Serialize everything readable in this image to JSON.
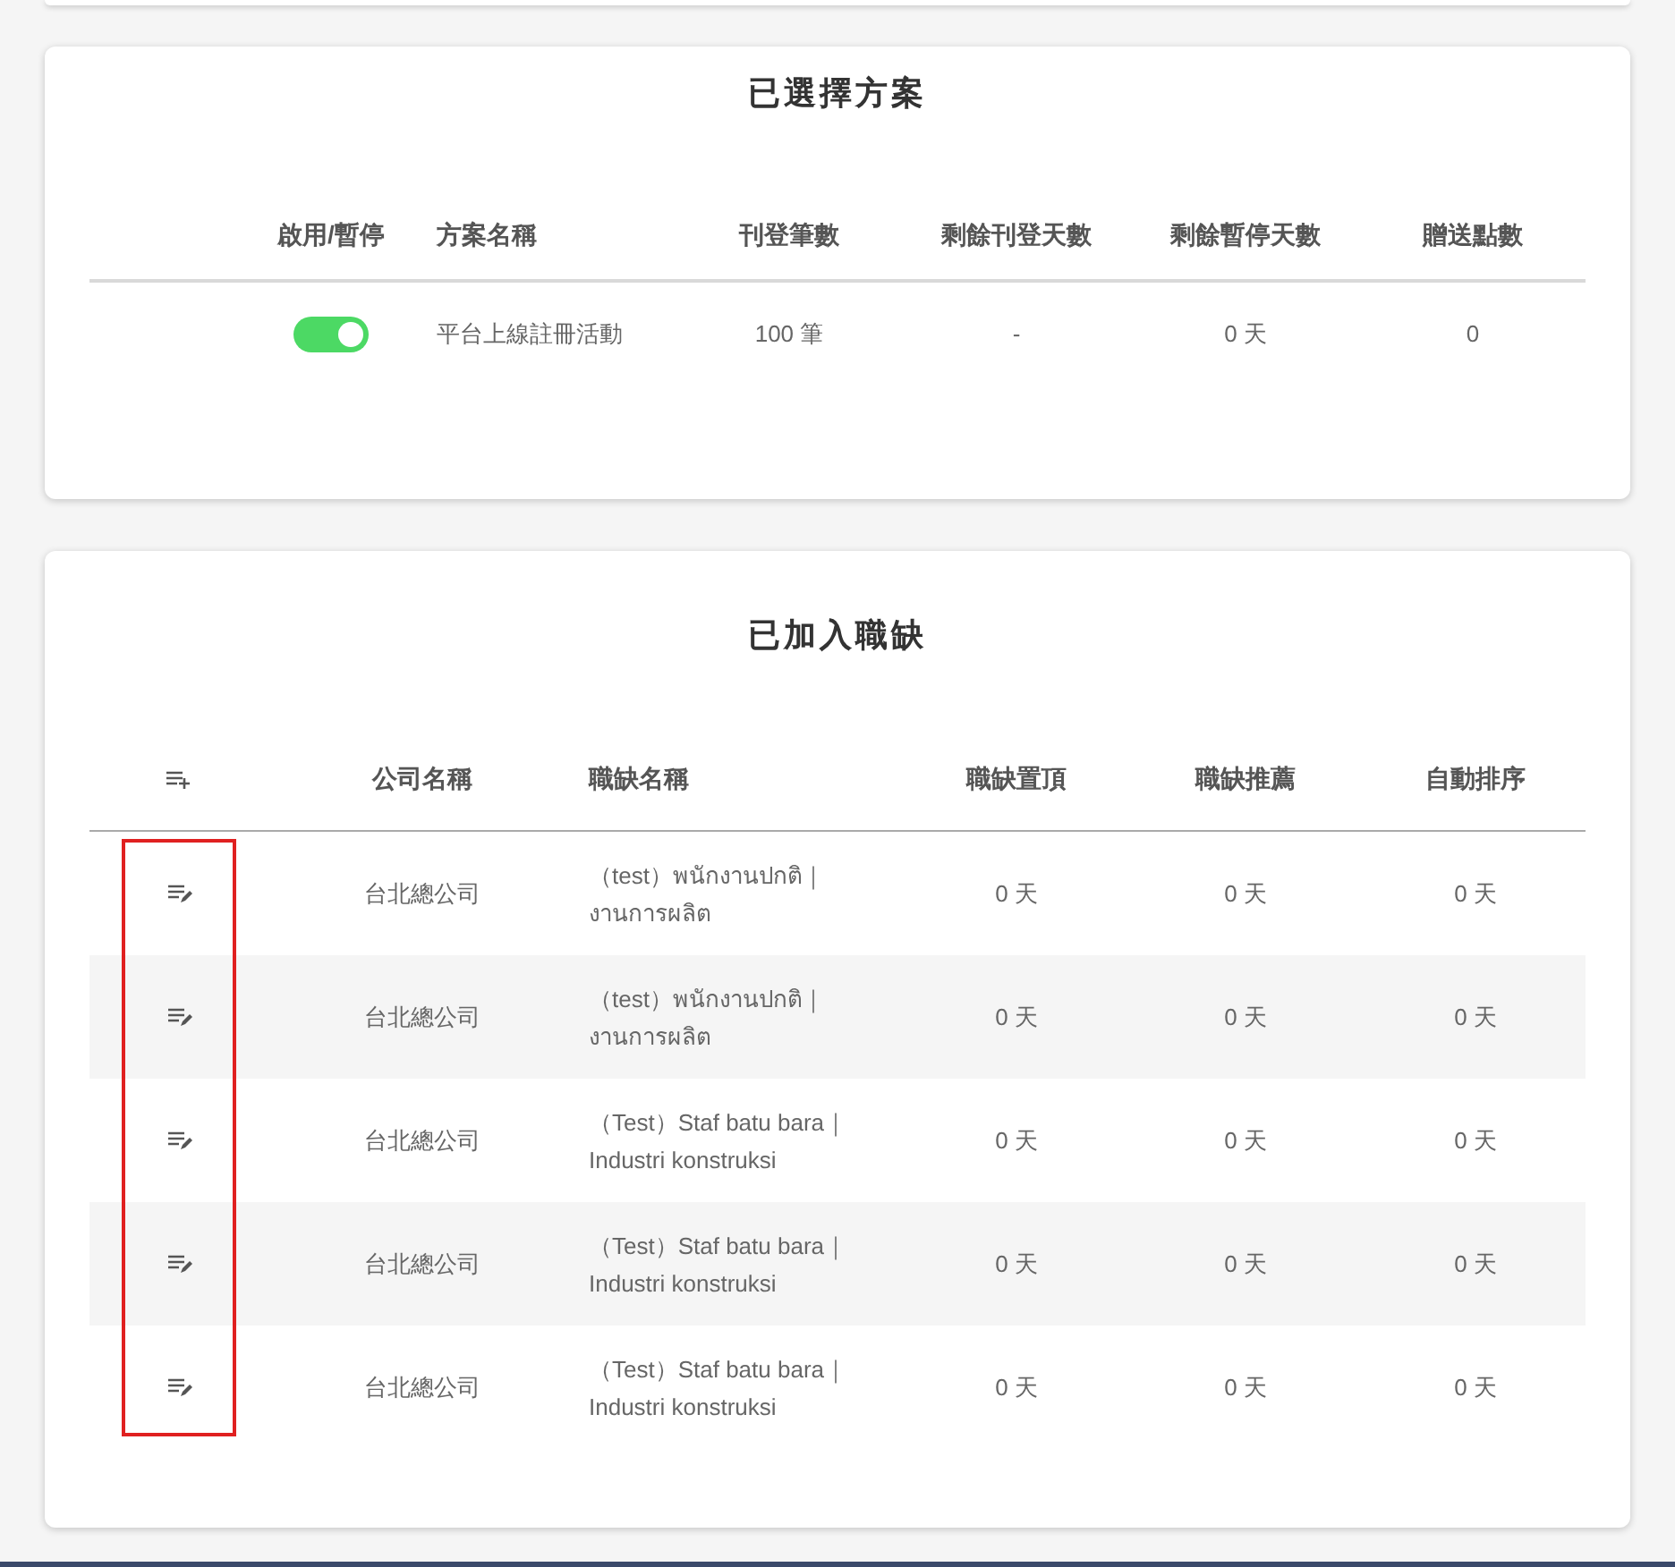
{
  "plan": {
    "title": "已選擇方案",
    "columns": [
      "啟用/暫停",
      "方案名稱",
      "刊登筆數",
      "剩餘刊登天數",
      "剩餘暫停天數",
      "贈送點數"
    ],
    "rows": [
      {
        "on": true,
        "name": "平台上線註冊活動",
        "count": "100 筆",
        "remaining_days": "-",
        "paused_days": "0 天",
        "points": "0"
      }
    ]
  },
  "jobs": {
    "title": "已加入職缺",
    "columns": [
      "公司名稱",
      "職缺名稱",
      "職缺置頂",
      "職缺推薦",
      "自動排序"
    ],
    "rows": [
      {
        "company": "台北總公司",
        "name_lines": [
          "（test）พนักงานปกติ｜",
          "งานการผลิต"
        ],
        "top": "0 天",
        "recommend": "0 天",
        "sort": "0 天"
      },
      {
        "company": "台北總公司",
        "name_lines": [
          "（test）พนักงานปกติ｜",
          "งานการผลิต"
        ],
        "top": "0 天",
        "recommend": "0 天",
        "sort": "0 天"
      },
      {
        "company": "台北總公司",
        "name_lines": [
          "（Test）Staf batu bara｜",
          "Industri konstruksi"
        ],
        "top": "0 天",
        "recommend": "0 天",
        "sort": "0 天"
      },
      {
        "company": "台北總公司",
        "name_lines": [
          "（Test）Staf batu bara｜",
          "Industri konstruksi"
        ],
        "top": "0 天",
        "recommend": "0 天",
        "sort": "0 天"
      },
      {
        "company": "台北總公司",
        "name_lines": [
          "（Test）Staf batu bara｜",
          "Industri konstruksi"
        ],
        "top": "0 天",
        "recommend": "0 天",
        "sort": "0 天"
      }
    ]
  }
}
